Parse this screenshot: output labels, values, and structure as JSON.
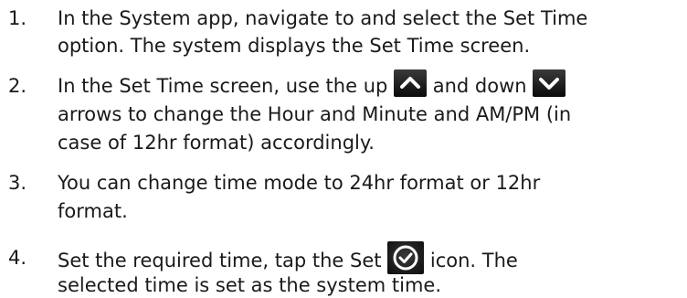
{
  "steps": [
    {
      "number": "1.",
      "line1": "In the System app, navigate to and select the Set Time",
      "line2": "option. The system displays the Set Time screen."
    },
    {
      "number": "2.",
      "line1_before_up": "In the Set Time screen, use the up",
      "line1_between": "and down",
      "line2": "arrows to change the Hour and Minute and AM/PM (in",
      "line3": "case of 12hr format) accordingly.",
      "up_icon": "chevron-up-icon",
      "down_icon": "chevron-down-icon"
    },
    {
      "number": "3.",
      "line1": "You can change time mode to 24hr format or 12hr",
      "line2": "format."
    },
    {
      "number": "4.",
      "line1_before_icon": "Set the required time, tap the Set",
      "line1_after_icon": "icon. The",
      "line2": "selected time is set as the system time.",
      "set_icon": "check-circle-icon"
    }
  ],
  "colors": {
    "text": "#1a1a1a",
    "icon_background": "#111111",
    "icon_glyph": "#ffffff"
  }
}
